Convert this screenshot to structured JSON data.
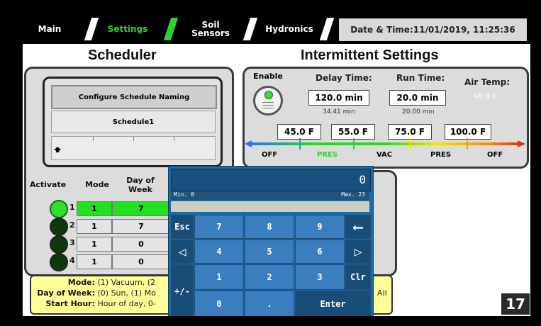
{
  "tabs": [
    {
      "label": "Main",
      "active": false
    },
    {
      "label": "Settings",
      "active": true
    },
    {
      "label": "Soil Sensors",
      "active": false
    },
    {
      "label": "Hydronics",
      "active": false
    }
  ],
  "datetime": "Date & Time:11/01/2019, 11:25:36",
  "scheduler": {
    "title": "Scheduler",
    "configure_label": "Configure Schedule Naming",
    "schedule_name": "Schedule1",
    "headers": {
      "activate": "Activate",
      "mode": "Mode",
      "day": "Day of Week"
    },
    "rows": [
      {
        "num": "1",
        "active": true,
        "mode": "1",
        "day": "7"
      },
      {
        "num": "2",
        "active": false,
        "mode": "1",
        "day": "7"
      },
      {
        "num": "3",
        "active": false,
        "mode": "1",
        "day": "0"
      },
      {
        "num": "4",
        "active": false,
        "mode": "1",
        "day": "0"
      }
    ]
  },
  "legend": {
    "mode_key": "Mode:",
    "mode_text": "(1) Vacuum, (2",
    "day_key": "Day of Week:",
    "day_text": "(0) Sun, (1) Mo",
    "hour_key": "Start Hour:",
    "hour_text": "Hour of day, 0-",
    "all": "All"
  },
  "intermittent": {
    "title": "Intermittent Settings",
    "enable_label": "Enable",
    "delay_label": "Delay Time:",
    "delay_value": "120.0 min",
    "delay_sub": "34.41 min",
    "run_label": "Run Time:",
    "run_value": "20.0 min",
    "run_sub": "20.00 min",
    "air_label": "Air Temp:",
    "air_value": "46.9 F",
    "thresholds": [
      "45.0 F",
      "55.0 F",
      "75.0 F",
      "100.0 F"
    ],
    "gauge_labels": [
      "OFF",
      "PRES",
      "VAC",
      "PRES",
      "OFF"
    ]
  },
  "keypad": {
    "value": "0",
    "min": "Min. 0",
    "max": "Max. 23",
    "keys": {
      "esc": "Esc",
      "k7": "7",
      "k8": "8",
      "k9": "9",
      "k4": "4",
      "k5": "5",
      "k6": "6",
      "sign": "+/-",
      "k1": "1",
      "k2": "2",
      "k3": "3",
      "clr": "Clr",
      "k0": "0",
      "dot": ".",
      "enter": "Enter"
    }
  },
  "screen_number": "17",
  "colors": {
    "accent_green": "#2fd12f",
    "keypad_blue": "#1f6aa0",
    "legend_yellow": "#ffff99"
  }
}
